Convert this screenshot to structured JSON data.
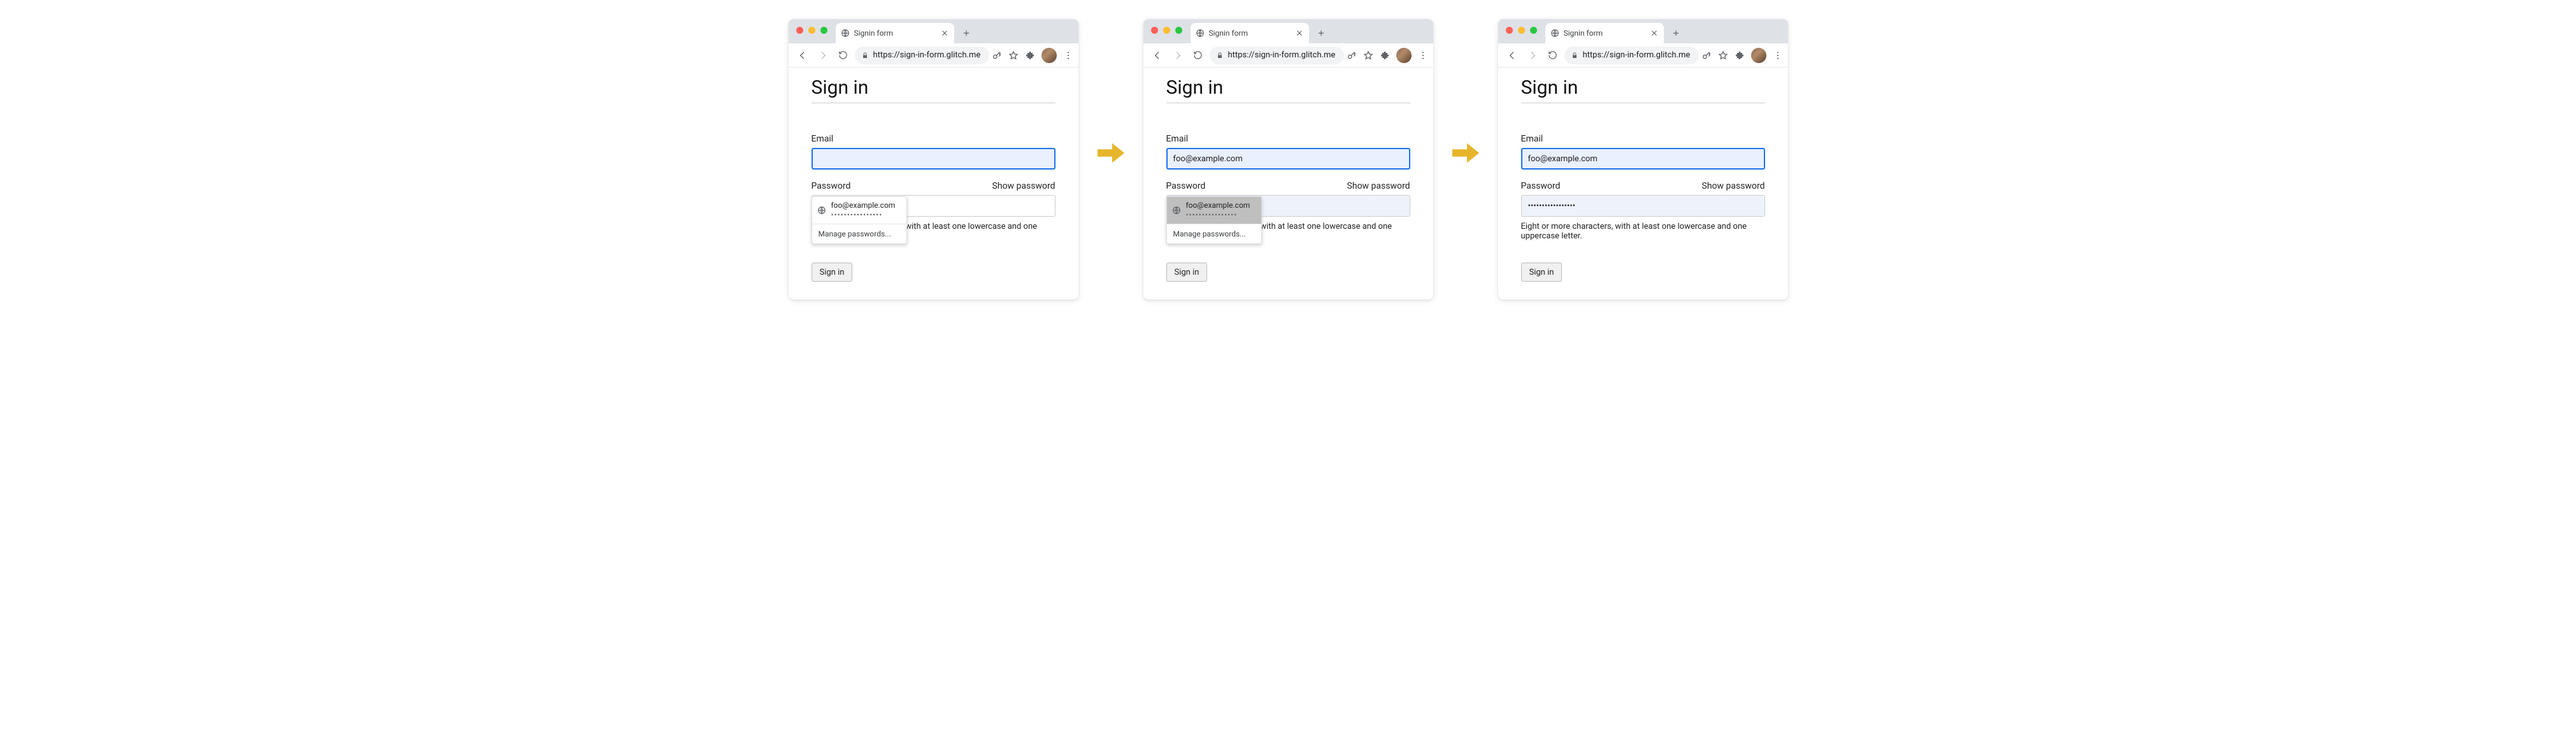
{
  "browser": {
    "tab_title": "Signin form",
    "url": "https://sign-in-form.glitch.me",
    "new_tab_label": "+"
  },
  "page": {
    "heading": "Sign in",
    "email_label": "Email",
    "password_label": "Password",
    "show_password": "Show password",
    "hint": "Eight or more characters, with at least one lowercase and one uppercase letter.",
    "signin_button": "Sign in"
  },
  "autofill": {
    "email": "foo@example.com",
    "password_mask": "••••••••••••••••",
    "manage": "Manage passwords..."
  },
  "values": {
    "frame2_email": "foo@example.com",
    "frame3_email": "foo@example.com",
    "frame3_password": "•••••••••••••••••"
  }
}
